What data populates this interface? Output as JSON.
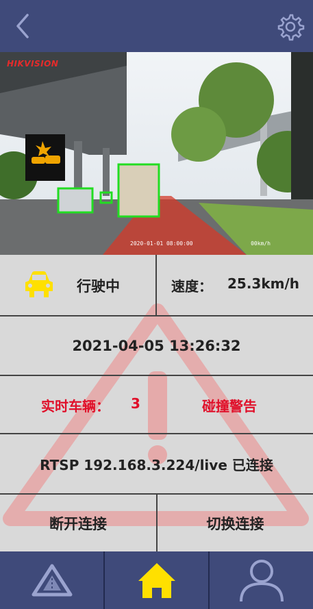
{
  "header": {
    "back_icon": "chevron-left-icon",
    "settings_icon": "gear-icon"
  },
  "video": {
    "brand": "HIKVISION",
    "osd_top": "",
    "osd_time": "2020-01-01 08:00:00",
    "osd_speed": "00km/h",
    "alert_icon": "collision-warning-icon"
  },
  "status": {
    "state_label": "行驶中",
    "speed_label": "速度：",
    "speed_value": "25.3km/h",
    "datetime": "2021-04-05 13:26:32",
    "vehicles_label": "实时车辆：",
    "vehicles_count": "3",
    "collision_warning": "碰撞警告",
    "connection": "RTSP 192.168.3.224/live 已连接"
  },
  "buttons": {
    "disconnect": "断开连接",
    "switch": "切换连接"
  },
  "nav": {
    "left_icon": "road-warning-icon",
    "center_icon": "home-icon",
    "right_icon": "user-icon"
  },
  "colors": {
    "bar": "#3f4a7a",
    "panel": "#d9d9d9",
    "warning": "#e0102a",
    "accent": "#ffe000",
    "detection": "#22dd22"
  }
}
